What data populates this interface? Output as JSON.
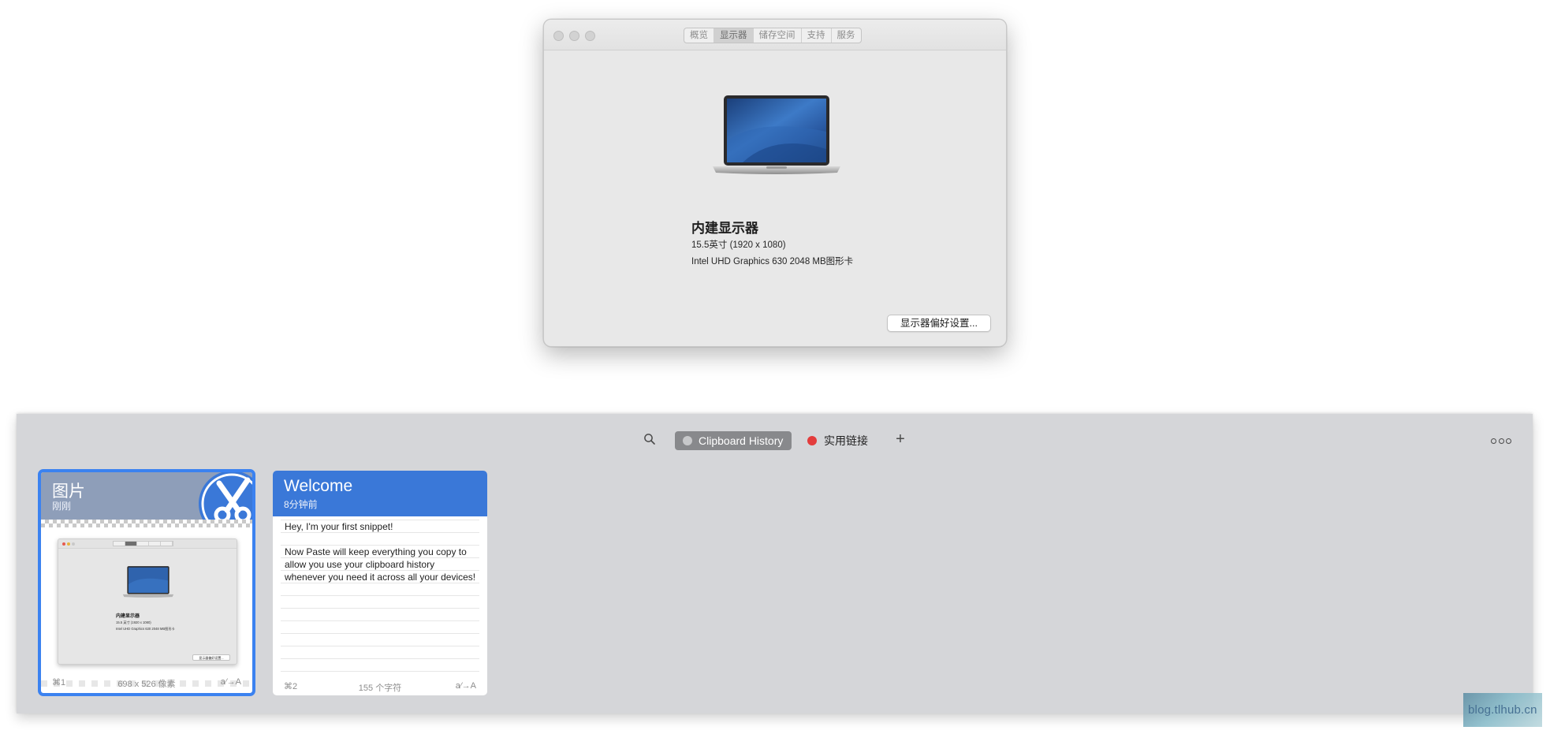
{
  "about_window": {
    "tabs": [
      {
        "label": "概览",
        "active": false
      },
      {
        "label": "显示器",
        "active": true
      },
      {
        "label": "储存空间",
        "active": false
      },
      {
        "label": "支持",
        "active": false
      },
      {
        "label": "服务",
        "active": false
      }
    ],
    "display_name": "内建显示器",
    "display_size": "15.5英寸 (1920 x 1080)",
    "display_gpu": "Intel UHD Graphics 630 2048 MB图形卡",
    "prefs_button": "显示器偏好设置..."
  },
  "paste_panel": {
    "toolbar": {
      "search_icon": "search-icon",
      "pinboards": [
        {
          "label": "Clipboard History",
          "color": "#c7c8ca",
          "active": true
        },
        {
          "label": "实用链接",
          "color": "#e33c3c",
          "active": false
        }
      ],
      "add_label": "+",
      "more_icon": "more-icon"
    },
    "cards": [
      {
        "title": "图片",
        "subtitle": "刚刚",
        "header_color": "#8e9eb9",
        "selected": true,
        "thumbnail": {
          "title": "内建显示器",
          "line1": "15.5 英寸 (1920 x 1080)",
          "line2": "Intel UHD Graphics 630 2048 MB图形卡",
          "button": "显示器偏好设置..."
        },
        "footer": {
          "shortcut": "⌘1",
          "info": "698 x 526 像素",
          "action": "a⁄→A"
        }
      },
      {
        "title": "Welcome",
        "subtitle": "8分钟前",
        "header_color": "#3a78d8",
        "selected": false,
        "body": [
          "Hey, I'm your first snippet!",
          "Now Paste will keep everything you copy to allow you use your clipboard history whenever you need it across all your devices!"
        ],
        "footer": {
          "shortcut": "⌘2",
          "info": "155 个字符",
          "action": "a⁄→A"
        }
      }
    ]
  },
  "watermark": "blog.tlhub.cn"
}
